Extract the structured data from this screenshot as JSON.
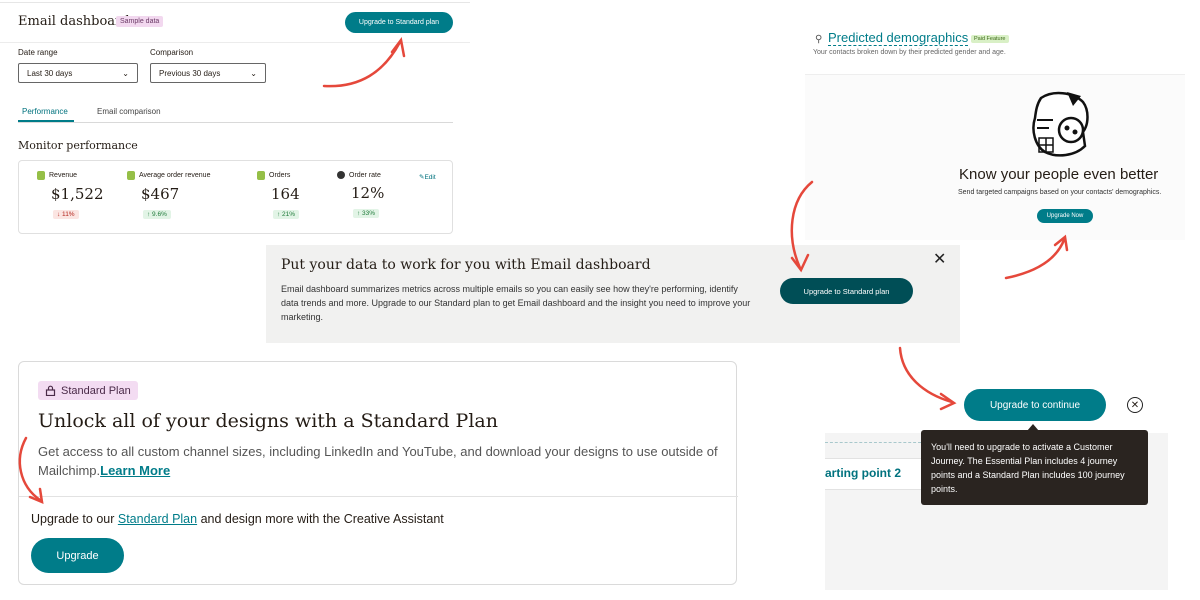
{
  "dashboard": {
    "title": "Email dashboard",
    "badge": "Sample data",
    "upgrade_label": "Upgrade to Standard plan",
    "date_range_label": "Date range",
    "date_range_value": "Last 30 days",
    "comparison_label": "Comparison",
    "comparison_value": "Previous 30 days",
    "tabs": [
      {
        "label": "Performance",
        "active": true
      },
      {
        "label": "Email comparison",
        "active": false
      }
    ],
    "section_title": "Monitor performance",
    "edit_label": "Edit",
    "metrics": [
      {
        "label": "Revenue",
        "value": "$1,522",
        "delta": "↓ 11%",
        "direction": "down"
      },
      {
        "label": "Average order revenue",
        "value": "$467",
        "delta": "↑ 9.6%",
        "direction": "up"
      },
      {
        "label": "Orders",
        "value": "164",
        "delta": "↑ 21%",
        "direction": "up"
      },
      {
        "label": "Order rate",
        "value": "12%",
        "delta": "↑ 33%",
        "direction": "up"
      }
    ]
  },
  "demographics": {
    "title": "Predicted demographics",
    "badge": "Paid Feature",
    "subtitle": "Your contacts broken down by their predicted gender and age.",
    "heading": "Know your people even better",
    "description": "Send targeted campaigns based on your contacts' demographics.",
    "upgrade_label": "Upgrade Now"
  },
  "banner": {
    "heading": "Put your data to work for you with Email dashboard",
    "body": "Email dashboard summarizes metrics across multiple emails so you can easily see how they're performing, identify data trends and more. Upgrade to our Standard plan to get Email dashboard and the insight you need to improve your marketing.",
    "upgrade_label": "Upgrade to Standard plan",
    "close_glyph": "✕"
  },
  "standard_plan": {
    "badge": "Standard Plan",
    "title": "Unlock all of your designs with a Standard Plan",
    "description": "Get access to all custom channel sizes, including LinkedIn and YouTube, and download your designs to use outside of Mailchimp.",
    "learn_more": "Learn More",
    "line_prefix": "Upgrade to our ",
    "line_link": "Standard Plan",
    "line_suffix": " and design more with the Creative Assistant",
    "upgrade_label": "Upgrade"
  },
  "journey": {
    "upgrade_label": "Upgrade to continue",
    "close_glyph": "✕",
    "row_text": "arting point 2",
    "tooltip": "You'll need to upgrade to activate a Customer Journey. The Essential Plan includes 4 journey points and a Standard Plan includes 100 journey points."
  },
  "colors": {
    "accent": "#007c89",
    "dark_accent": "#004e56",
    "arrow": "#e5483b"
  }
}
